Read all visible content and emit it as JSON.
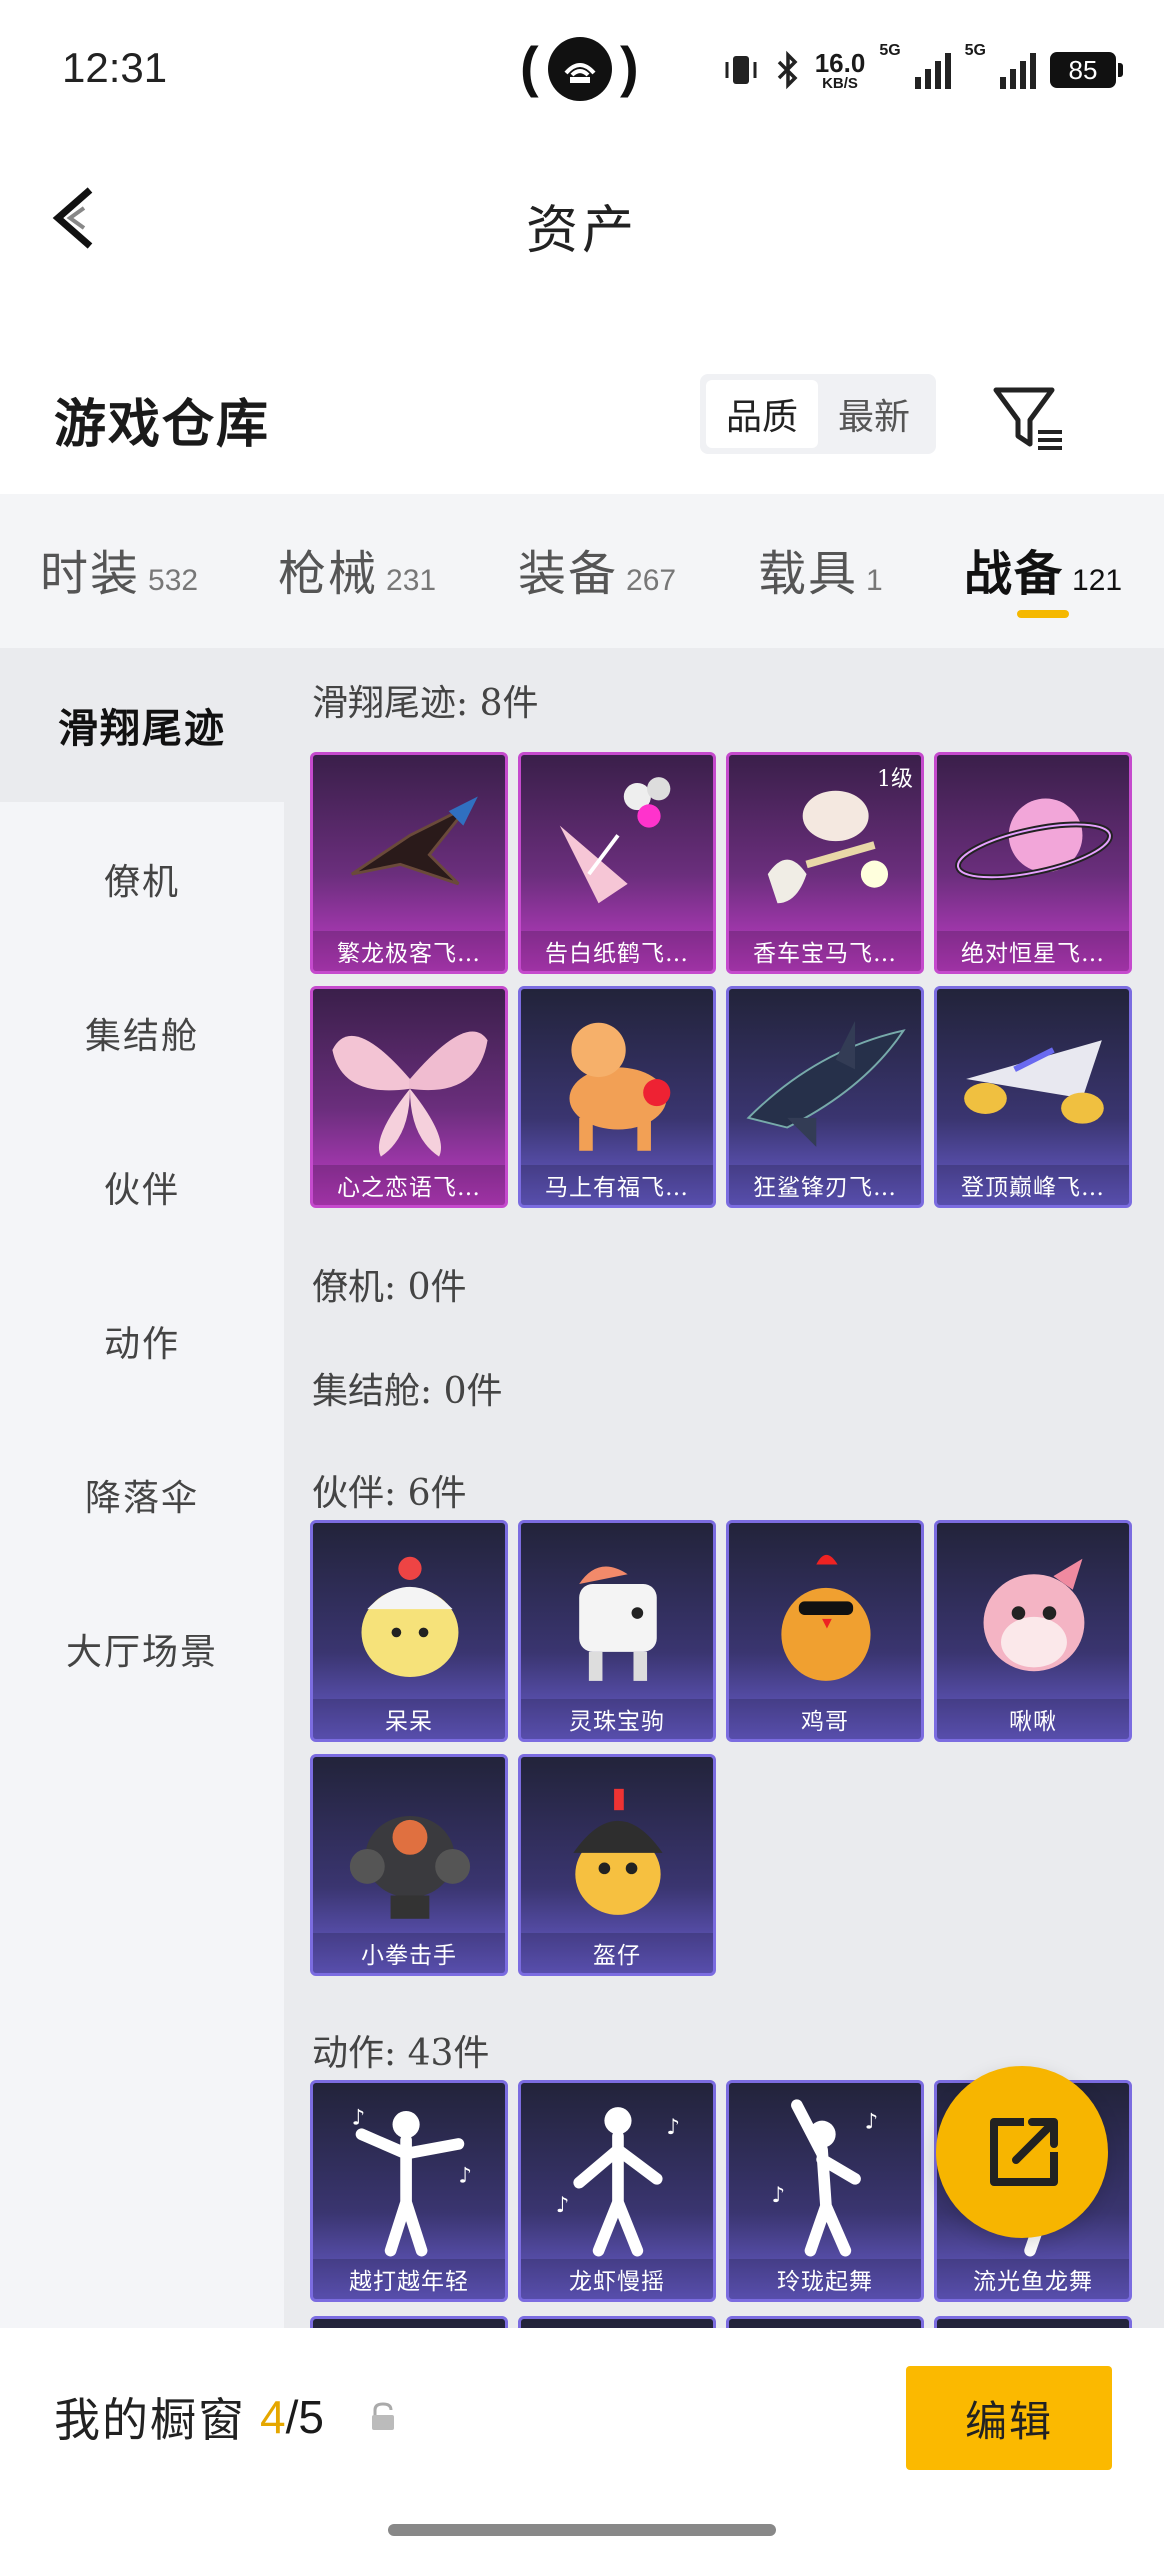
{
  "status_bar": {
    "time": "12:31",
    "net_speed_value": "16.0",
    "net_speed_unit": "KB/S",
    "net_label_1": "5G",
    "net_label_2": "5G",
    "battery": "85"
  },
  "header": {
    "title": "资产",
    "section_title": "游戏仓库",
    "sort_options": [
      "品质",
      "最新"
    ],
    "active_sort": "品质"
  },
  "tabs": [
    {
      "name": "时装",
      "count": "532"
    },
    {
      "name": "枪械",
      "count": "231"
    },
    {
      "name": "装备",
      "count": "267"
    },
    {
      "name": "载具",
      "count": "1"
    },
    {
      "name": "战备",
      "count": "121"
    }
  ],
  "active_tab": "战备",
  "sidebar": [
    {
      "label": "滑翔尾迹"
    },
    {
      "label": "僚机"
    },
    {
      "label": "集结舱"
    },
    {
      "label": "伙伴"
    },
    {
      "label": "动作"
    },
    {
      "label": "降落伞"
    },
    {
      "label": "大厅场景"
    }
  ],
  "sections": {
    "glide": {
      "label": "滑翔尾迹: 8件",
      "items": [
        {
          "name": "繁龙极客飞…",
          "rarity": "purple"
        },
        {
          "name": "告白纸鹤飞…",
          "rarity": "purple"
        },
        {
          "name": "香车宝马飞…",
          "rarity": "purple",
          "level": "1级"
        },
        {
          "name": "绝对恒星飞…",
          "rarity": "purple"
        },
        {
          "name": "心之恋语飞…",
          "rarity": "purple"
        },
        {
          "name": "马上有福飞…",
          "rarity": "blue"
        },
        {
          "name": "狂鲨锋刃飞…",
          "rarity": "blue"
        },
        {
          "name": "登顶巅峰飞…",
          "rarity": "blue"
        }
      ]
    },
    "wingman": {
      "label": "僚机: 0件"
    },
    "pod": {
      "label": "集结舱: 0件"
    },
    "partner": {
      "label": "伙伴: 6件",
      "items": [
        {
          "name": "呆呆",
          "rarity": "blue"
        },
        {
          "name": "灵珠宝驹",
          "rarity": "blue"
        },
        {
          "name": "鸡哥",
          "rarity": "blue"
        },
        {
          "name": "啾啾",
          "rarity": "blue"
        },
        {
          "name": "小拳击手",
          "rarity": "blue"
        },
        {
          "name": "盔仔",
          "rarity": "blue"
        }
      ]
    },
    "emote": {
      "label": "动作: 43件",
      "items": [
        {
          "name": "越打越年轻",
          "rarity": "blue"
        },
        {
          "name": "龙虾慢摇",
          "rarity": "blue"
        },
        {
          "name": "玲珑起舞",
          "rarity": "blue"
        },
        {
          "name": "流光鱼龙舞",
          "rarity": "blue"
        }
      ]
    }
  },
  "bottom": {
    "showcase_label": "我的橱窗",
    "showcase_current": "4",
    "showcase_total": "/5",
    "edit_label": "编辑"
  },
  "colors": {
    "accent": "#f7b500",
    "purple_rarity": "#c54acd",
    "blue_rarity": "#7b6ce0"
  }
}
